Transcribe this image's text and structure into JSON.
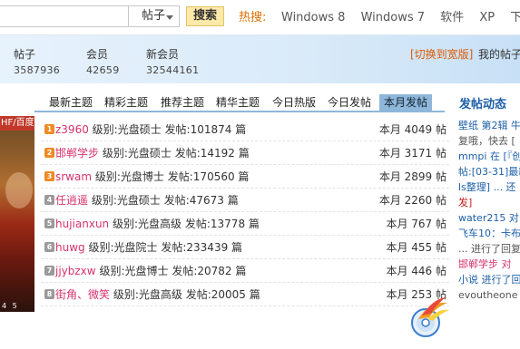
{
  "search": {
    "select_label": "帖子",
    "button_label": "搜索"
  },
  "hot": {
    "label": "热搜:",
    "items": [
      "Windows 8",
      "Windows 7",
      "软件",
      "XP",
      "下载"
    ]
  },
  "stats": [
    {
      "label": "帖子",
      "value": "3587936"
    },
    {
      "label": "会员",
      "value": "42659"
    },
    {
      "label": "新会员",
      "value": "32544161"
    }
  ],
  "switch_wide": "[切换到宽版]",
  "my_posts": "我的帖子",
  "left_image": {
    "caption": "HF/百度",
    "numbers": "4 5"
  },
  "tabs": [
    "最新主题",
    "精彩主题",
    "推荐主题",
    "精华主题",
    "今日热版",
    "今日发帖",
    "本月发帖"
  ],
  "active_tab": "本月发帖",
  "rows": [
    {
      "rank": "1",
      "user": "z3960",
      "level": "级别:光盘硕士",
      "posts": "发帖:101874 篇",
      "month": "本月 4049 帖"
    },
    {
      "rank": "2",
      "user": "邯郸学步",
      "level": "级别:光盘硕士",
      "posts": "发帖:14192 篇",
      "month": "本月 3171 帖"
    },
    {
      "rank": "3",
      "user": "srwam",
      "level": "级别:光盘博士",
      "posts": "发帖:170560 篇",
      "month": "本月 2899 帖"
    },
    {
      "rank": "4",
      "user": "任逍遥",
      "level": "级别:光盘硕士",
      "posts": "发帖:47673 篇",
      "month": "本月 2260 帖"
    },
    {
      "rank": "5",
      "user": "hujianxun",
      "level": "级别:光盘高级",
      "posts": "发帖:13778 篇",
      "month": "本月 767 帖"
    },
    {
      "rank": "6",
      "user": "huwg",
      "level": "级别:光盘院士",
      "posts": "发帖:233439 篇",
      "month": "本月 455 帖"
    },
    {
      "rank": "7",
      "user": "jjybzxw",
      "level": "级别:光盘博士",
      "posts": "发帖:20782 篇",
      "month": "本月 446 帖"
    },
    {
      "rank": "8",
      "user": "街角、微笑",
      "level": "级别:光盘高级",
      "posts": "发帖:20005 篇",
      "month": "本月 253 帖"
    }
  ],
  "feed": {
    "title": "发帖动态",
    "lines": [
      "壁纸 第2辑 牛",
      "复哦，快去 [",
      "mmpi 在 [『创",
      "帖:[03-31]最新",
      "ls整理] ... 还",
      "发]",
      "water215 对",
      "飞车10：卡布",
      "... 进行了回复",
      "邯郸学步 对",
      "小说 进行了回",
      "evoutheone 对"
    ]
  },
  "colors": {
    "accent_blue": "#1d5fa7",
    "hot_orange": "#e06e00",
    "user_pink": "#d6336c",
    "tab_active": "#8fb7da"
  }
}
